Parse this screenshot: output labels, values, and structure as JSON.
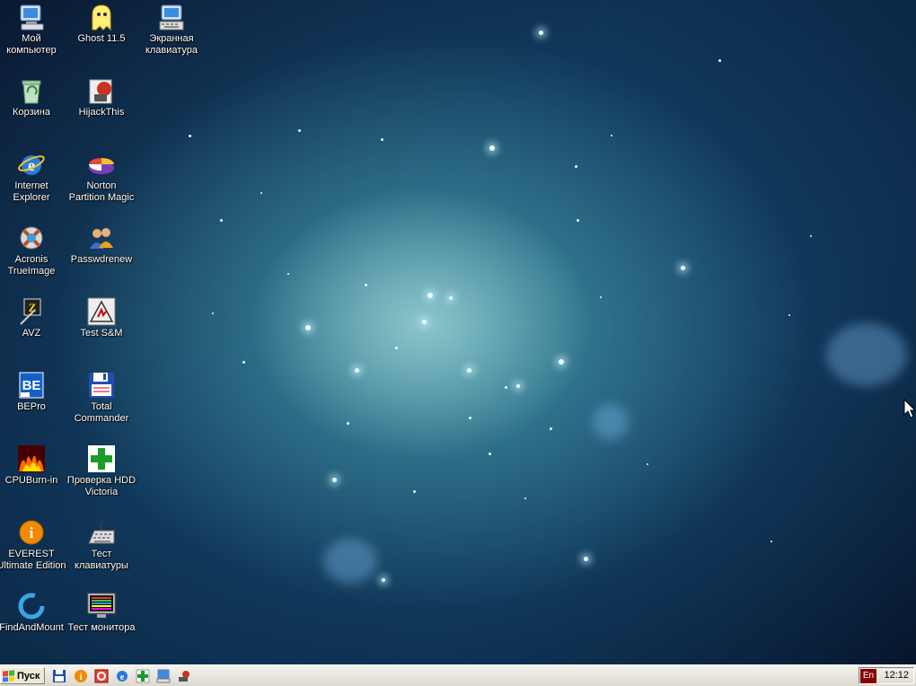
{
  "desktop": {
    "icons": [
      {
        "label": "Мой\nкомпьютер",
        "icon": "my-computer-icon"
      },
      {
        "label": "Ghost 11.5",
        "icon": "ghost-icon"
      },
      {
        "label": "Экранная\nклавиатура",
        "icon": "on-screen-keyboard-icon"
      },
      {
        "label": "Корзина",
        "icon": "recycle-bin-icon"
      },
      {
        "label": "HijackThis",
        "icon": "hijackthis-icon"
      },
      {
        "label": "Internet\nExplorer",
        "icon": "internet-explorer-icon"
      },
      {
        "label": "Norton\nPartition Magic",
        "icon": "partition-magic-icon"
      },
      {
        "label": "Acronis\nTrueImage",
        "icon": "acronis-icon"
      },
      {
        "label": "Passwdrenew",
        "icon": "users-icon"
      },
      {
        "label": "AVZ",
        "icon": "avz-icon"
      },
      {
        "label": "Test S&M",
        "icon": "test-sm-icon"
      },
      {
        "label": "BEPro",
        "icon": "bepro-icon"
      },
      {
        "label": "Total\nCommander",
        "icon": "floppy-disk-icon"
      },
      {
        "label": "CPUBurn-in",
        "icon": "fire-icon"
      },
      {
        "label": "Проверка HDD\nVictoria",
        "icon": "green-cross-icon"
      },
      {
        "label": "EVEREST\nUltimate Edition",
        "icon": "info-icon"
      },
      {
        "label": "Тест\nклавиатуры",
        "icon": "keyboard-icon"
      },
      {
        "label": "FindAndMount",
        "icon": "findandmount-icon"
      },
      {
        "label": "Тест монитора",
        "icon": "monitor-icon"
      }
    ]
  },
  "taskbar": {
    "start_label": "Пуск",
    "quick_launch": [
      "floppy-disk-icon",
      "info-icon",
      "red-square-icon",
      "internet-explorer-icon",
      "green-cross-icon",
      "on-screen-keyboard-icon",
      "hijackthis-icon"
    ],
    "language": "En",
    "clock": "12:12"
  }
}
